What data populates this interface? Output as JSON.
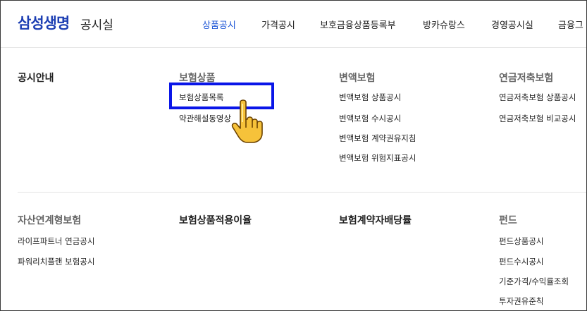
{
  "logo": "삼성생명",
  "site_title": "공시실",
  "nav": [
    "상품공시",
    "가격공시",
    "보호금융상품등록부",
    "방카슈랑스",
    "경영공시실",
    "금융그"
  ],
  "menu": {
    "col1": {
      "title": "공시안내"
    },
    "col2": {
      "title": "보험상품",
      "items": [
        "보험상품목록",
        "약관해설동영상"
      ]
    },
    "col3": {
      "title": "변액보험",
      "items": [
        "변액보험 상품공시",
        "변액보험 수시공시",
        "변액보험 계약권유지침",
        "변액보험 위험지표공시"
      ]
    },
    "col4": {
      "title": "연금저축보험",
      "items": [
        "연금저축보험 상품공시",
        "연금저축보험 비교공시"
      ]
    },
    "col5": {
      "title": "자산연계형보험",
      "items": [
        "라이프파트너 연금공시",
        "파워리치플랜 보험공시"
      ]
    },
    "col6": {
      "title": "보험상품적용이율"
    },
    "col7": {
      "title": "보험계약자배당률"
    },
    "col8": {
      "title": "펀드",
      "items": [
        "펀드상품공시",
        "펀드수시공시",
        "기준가격/수익률조회",
        "투자권유준칙"
      ]
    }
  },
  "colors": {
    "brand": "#1d3fb3",
    "active_nav": "#1d56d6",
    "highlight": "#0a16e8"
  },
  "icons": {
    "pointer": "hand-pointer-icon"
  }
}
